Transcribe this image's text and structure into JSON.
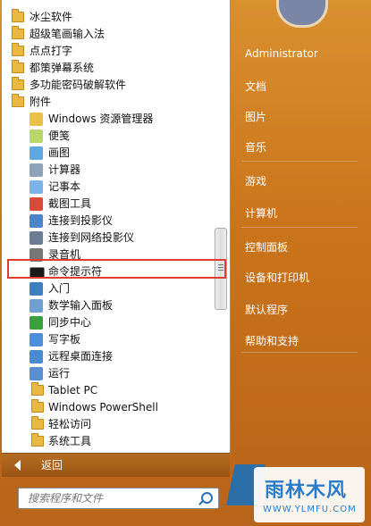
{
  "left_menu": {
    "items": [
      {
        "label": "冰尘软件",
        "type": "folder"
      },
      {
        "label": "超级笔画输入法",
        "type": "folder"
      },
      {
        "label": "点点打字",
        "type": "folder"
      },
      {
        "label": "都策弹幕系统",
        "type": "folder"
      },
      {
        "label": "多功能密码破解软件",
        "type": "folder"
      },
      {
        "label": "附件",
        "type": "folder"
      },
      {
        "label": "Windows 资源管理器",
        "type": "app",
        "icon": "explorer-icon",
        "color": "#e8c04a"
      },
      {
        "label": "便笺",
        "type": "app",
        "icon": "sticky-notes-icon",
        "color": "#b9d66a"
      },
      {
        "label": "画图",
        "type": "app",
        "icon": "paint-icon",
        "color": "#5ea7e0"
      },
      {
        "label": "计算器",
        "type": "app",
        "icon": "calculator-icon",
        "color": "#8fa3b8"
      },
      {
        "label": "记事本",
        "type": "app",
        "icon": "notepad-icon",
        "color": "#7db3e8"
      },
      {
        "label": "截图工具",
        "type": "app",
        "icon": "snipping-tool-icon",
        "color": "#d94a3a"
      },
      {
        "label": "连接到投影仪",
        "type": "app",
        "icon": "projector-icon",
        "color": "#4a86c8"
      },
      {
        "label": "连接到网络投影仪",
        "type": "app",
        "icon": "network-projector-icon",
        "color": "#6b7c93"
      },
      {
        "label": "录音机",
        "type": "app",
        "icon": "microphone-icon",
        "color": "#777777"
      },
      {
        "label": "命令提示符",
        "type": "app",
        "icon": "cmd-icon",
        "color": "#1a1a1a",
        "highlighted": true
      },
      {
        "label": "入门",
        "type": "app",
        "icon": "getting-started-icon",
        "color": "#3f7fc0"
      },
      {
        "label": "数学输入面板",
        "type": "app",
        "icon": "math-input-icon",
        "color": "#6fa0d0"
      },
      {
        "label": "同步中心",
        "type": "app",
        "icon": "sync-center-icon",
        "color": "#3aa040"
      },
      {
        "label": "写字板",
        "type": "app",
        "icon": "wordpad-icon",
        "color": "#4c8ed8"
      },
      {
        "label": "远程桌面连接",
        "type": "app",
        "icon": "remote-desktop-icon",
        "color": "#4a8bd0"
      },
      {
        "label": "运行",
        "type": "app",
        "icon": "run-icon",
        "color": "#5a8fd0"
      },
      {
        "label": "Tablet PC",
        "type": "subfolder"
      },
      {
        "label": "Windows PowerShell",
        "type": "subfolder"
      },
      {
        "label": "轻松访问",
        "type": "subfolder"
      },
      {
        "label": "系统工具",
        "type": "subfolder"
      }
    ]
  },
  "back_label": "返回",
  "search": {
    "placeholder": "搜索程序和文件"
  },
  "right_menu": {
    "items": [
      "Administrator",
      "文档",
      "图片",
      "音乐",
      "游戏",
      "计算机",
      "控制面板",
      "设备和打印机",
      "默认程序",
      "帮助和支持"
    ]
  },
  "watermark": {
    "main": "雨林木风",
    "url": "WWW.YLMFU.COM"
  }
}
